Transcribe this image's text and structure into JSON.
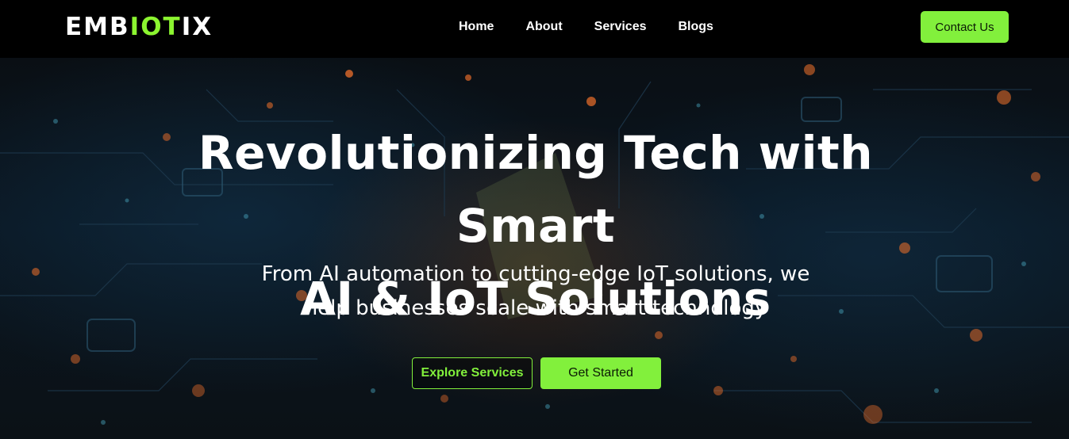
{
  "brand": {
    "logo_left": "EMB",
    "logo_accent": "IOT",
    "logo_right": "IX",
    "accent_color": "#82f03c"
  },
  "nav": {
    "items": [
      {
        "label": "Home"
      },
      {
        "label": "About"
      },
      {
        "label": "Services"
      },
      {
        "label": "Blogs"
      }
    ],
    "cta_label": "Contact Us"
  },
  "hero": {
    "title_line1": "Revolutionizing Tech with Smart",
    "title_line2": "AI & IoT Solutions",
    "subtitle_line1": "From AI automation to cutting-edge IoT solutions, we",
    "subtitle_line2": "help businesses scale with smart technology",
    "secondary_button": "Explore Services",
    "primary_button": "Get Started"
  }
}
